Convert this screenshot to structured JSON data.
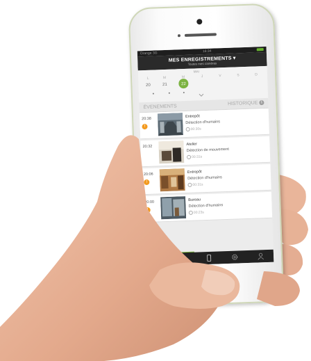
{
  "status_bar": {
    "carrier": "Orange  3G",
    "time": "16:34"
  },
  "header": {
    "title": "MES ENREGISTREMENTS",
    "subtitle": "Toutes mes caméras"
  },
  "calendar": {
    "month": "MAI",
    "weekdays": [
      "L",
      "M",
      "M",
      "J",
      "V",
      "S",
      "D"
    ],
    "days": [
      "20",
      "21",
      "22",
      "",
      "",
      "",
      ""
    ],
    "selected_day": "22"
  },
  "tabs": {
    "events_label": "ÉVENEMENTS",
    "history_label": "HISTORIQUE",
    "history_badge": "1"
  },
  "events": [
    {
      "time": "20:38",
      "camera": "Entrepôt",
      "type": "Détection d'humains",
      "duration": "00:30s",
      "alert": true
    },
    {
      "time": "20:32",
      "camera": "Atelier",
      "type": "Détection de mouvement",
      "duration": "00:31s",
      "alert": false
    },
    {
      "time": "20:06",
      "camera": "Entrepôt",
      "type": "Détection d'humains",
      "duration": "00:31s",
      "alert": true
    },
    {
      "time": "20:00",
      "camera": "Bureau",
      "type": "Détection d'humains",
      "duration": "00:23s",
      "alert": true
    }
  ],
  "bottom_nav": [
    {
      "icon": "microphone-icon"
    },
    {
      "icon": "user-icon",
      "active": true
    },
    {
      "icon": "phone-icon"
    },
    {
      "icon": "gear-icon"
    },
    {
      "icon": "profile-icon"
    }
  ],
  "colors": {
    "accent": "#7cb342",
    "alert": "#f39a1e",
    "header_bg": "#2a2a2a"
  }
}
